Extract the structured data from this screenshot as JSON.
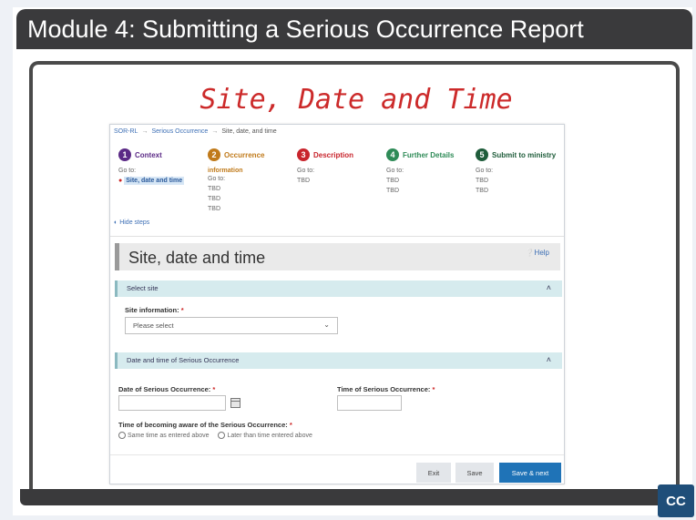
{
  "module": {
    "title": "Module 4:  Submitting a Serious Occurrence Report"
  },
  "slide_heading": "Site, Date and Time",
  "breadcrumb": {
    "items": [
      "SOR-RL",
      "Serious Occurrence",
      "Site, date, and time"
    ],
    "separator": "→"
  },
  "steps": [
    {
      "number": "1",
      "label": "Context",
      "color": "#5b2a86",
      "go_to": "Go to:",
      "link": "Site, date and time"
    },
    {
      "number": "2",
      "label": "Occurrence",
      "label2": "information",
      "color": "#c07a1a",
      "go_to": "Go to:",
      "items": [
        "TBD",
        "TBD",
        "TBD"
      ]
    },
    {
      "number": "3",
      "label": "Description",
      "color": "#c8242c",
      "go_to": "Go to:",
      "items": [
        "TBD"
      ]
    },
    {
      "number": "4",
      "label": "Further Details",
      "color": "#2e8b57",
      "go_to": "Go to:",
      "items": [
        "TBD",
        "TBD"
      ]
    },
    {
      "number": "5",
      "label": "Submit to ministry",
      "color": "#1e5c3a",
      "go_to": "Go to:",
      "items": [
        "TBD",
        "TBD"
      ]
    }
  ],
  "hide_steps": "Hide steps",
  "page": {
    "title": "Site, date and time",
    "help": "Help"
  },
  "sections": {
    "select_site": {
      "label": "Select site",
      "field_label": "Site information:",
      "required_mark": "*",
      "select_value": "Please select"
    },
    "date_time": {
      "label": "Date and time of Serious Occurrence",
      "date_label": "Date of Serious Occurrence:",
      "time_label": "Time of Serious Occurrence:",
      "aware_label": "Time of becoming aware of the Serious Occurrence:",
      "required_mark": "*",
      "radio_options": [
        "Same time as entered above",
        "Later than time entered above"
      ]
    }
  },
  "buttons": {
    "exit": "Exit",
    "save": "Save",
    "save_next": "Save & next"
  },
  "cc_label": "CC",
  "colors": {
    "header_bg": "#3a3a3c",
    "handwriting": "#cc2a2a",
    "section_bg": "#d6ebee",
    "primary_button": "#1f73b7",
    "cc_button": "#1f4e79"
  }
}
